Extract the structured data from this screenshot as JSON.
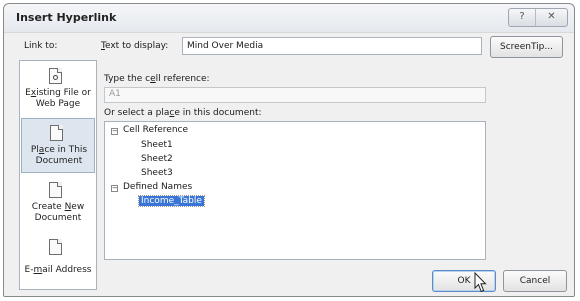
{
  "dialog": {
    "title": "Insert Hyperlink",
    "help_label": "?",
    "close_label": "✕"
  },
  "link_to": {
    "label": "Link to:",
    "items": [
      {
        "label": "Existing File or Web Page",
        "icon": "globe-document-icon"
      },
      {
        "label": "Place in This Document",
        "icon": "place-in-document-icon",
        "selected": true
      },
      {
        "label": "Create New Document",
        "icon": "new-document-icon"
      },
      {
        "label": "E-mail Address",
        "icon": "email-icon"
      }
    ]
  },
  "text_to_display": {
    "label": "Text to display:",
    "value": "Mind Over Media"
  },
  "screentip_label": "ScreenTip...",
  "cell_reference": {
    "label": "Type the cell reference:",
    "value": "A1"
  },
  "place_label": "Or select a place in this document:",
  "tree": {
    "cell_reference": {
      "label": "Cell Reference",
      "expander": "−"
    },
    "sheets": [
      "Sheet1",
      "Sheet2",
      "Sheet3"
    ],
    "defined_names": {
      "label": "Defined Names",
      "expander": "−"
    },
    "names": [
      "Income_Table"
    ]
  },
  "buttons": {
    "ok": "OK",
    "cancel": "Cancel"
  }
}
